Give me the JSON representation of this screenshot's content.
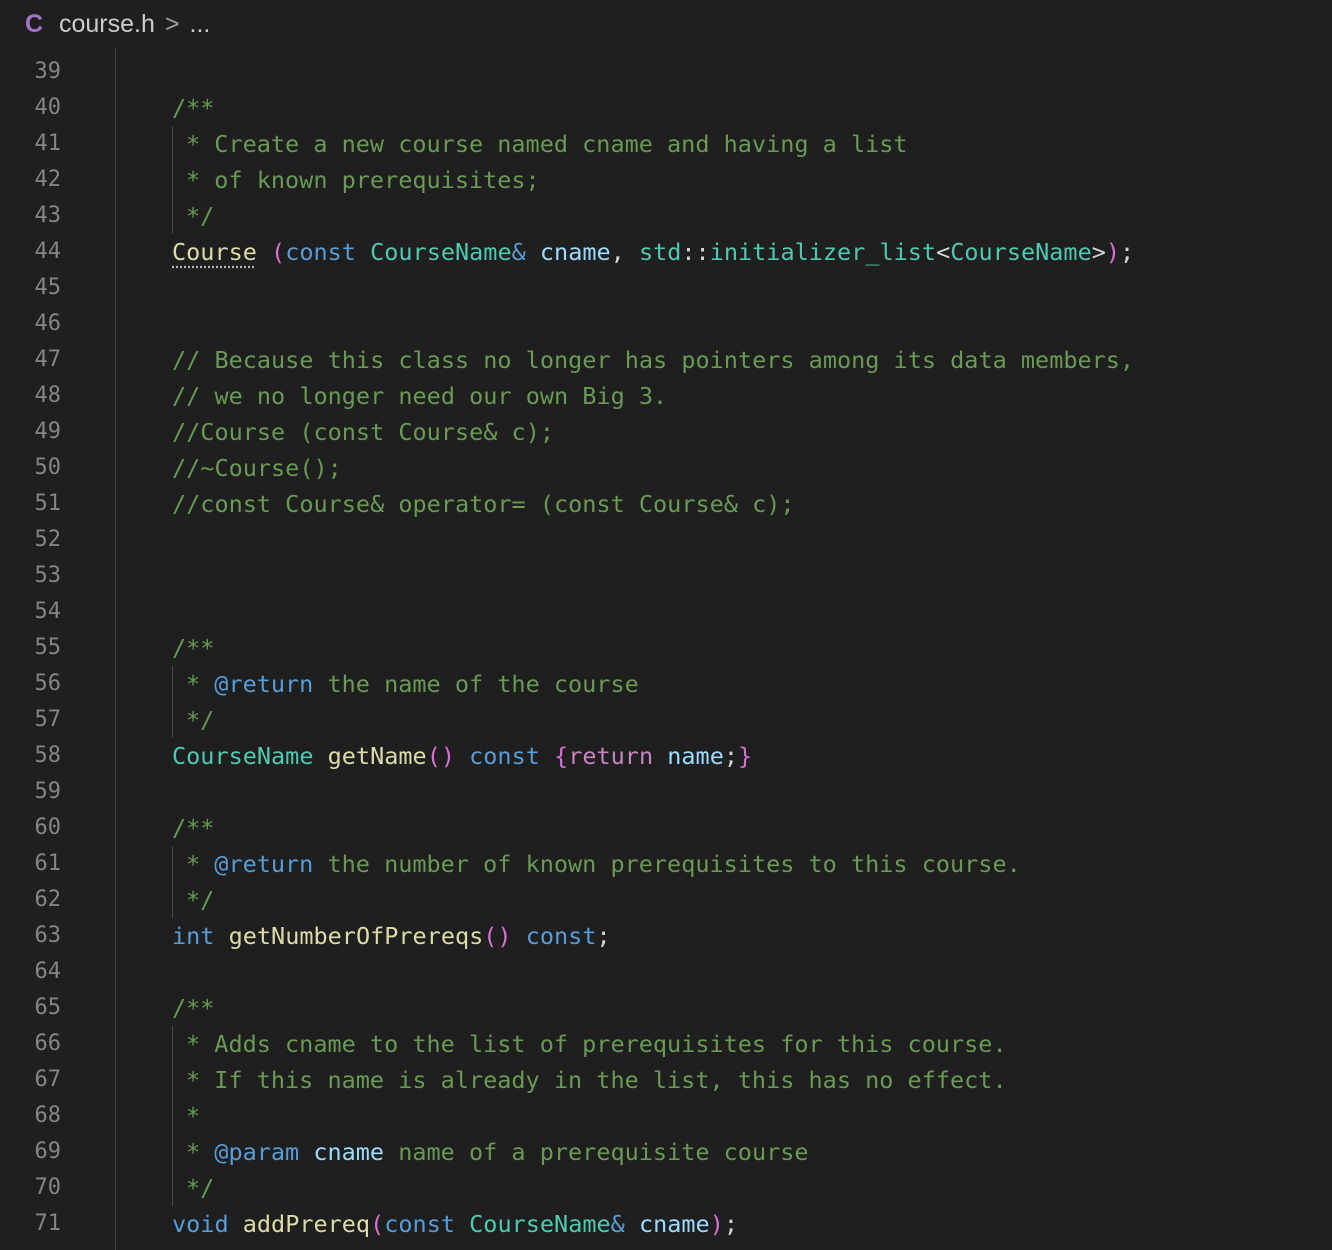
{
  "breadcrumb": {
    "lang_icon": "C",
    "file": "course.h",
    "separator": ">",
    "more": "..."
  },
  "line_numbers": [
    "39",
    "40",
    "41",
    "42",
    "43",
    "44",
    "45",
    "46",
    "47",
    "48",
    "49",
    "50",
    "51",
    "52",
    "53",
    "54",
    "55",
    "56",
    "57",
    "58",
    "59",
    "60",
    "61",
    "62",
    "63",
    "64",
    "65",
    "66",
    "67",
    "68",
    "69",
    "70",
    "71"
  ],
  "code": {
    "l40": "/**",
    "l41": "* Create a new course named cname and having a list",
    "l42": "* of known prerequisites;",
    "l43": "*/",
    "l44": {
      "t1": "Course",
      "t2": " ",
      "t3": "(",
      "t4": "const",
      "t5": " ",
      "t6": "CourseName",
      "t7": "&",
      "t8": " ",
      "t9": "cname",
      "t10": ", ",
      "t11": "std",
      "t12": "::",
      "t13": "initializer_list",
      "t14": "<",
      "t15": "CourseName",
      "t16": ">",
      "t17": ")",
      "t18": ";"
    },
    "l47": "// Because this class no longer has pointers among its data members,",
    "l48": "// we no longer need our own Big 3.",
    "l49": "//Course (const Course& c);",
    "l50": "//~Course();",
    "l51": "//const Course& operator= (const Course& c);",
    "l55": "/**",
    "l56": {
      "a": "* ",
      "b": "@return",
      "c": " the name of the course"
    },
    "l57": "*/",
    "l58": {
      "t1": "CourseName",
      "t2": " ",
      "t3": "getName",
      "t4": "()",
      "t5": " ",
      "t6": "const",
      "t7": " ",
      "t8": "{",
      "t9": "return",
      "t10": " ",
      "t11": "name",
      "t12": ";",
      "t13": "}"
    },
    "l60": "/**",
    "l61": {
      "a": "* ",
      "b": "@return",
      "c": " the number of known prerequisites to this course."
    },
    "l62": "*/",
    "l63": {
      "t1": "int",
      "t2": " ",
      "t3": "getNumberOfPrereqs",
      "t4": "()",
      "t5": " ",
      "t6": "const",
      "t7": ";"
    },
    "l65": "/**",
    "l66": "* Adds cname to the list of prerequisites for this course.",
    "l67": "* If this name is already in the list, this has no effect.",
    "l68": "*",
    "l69": {
      "a": "* ",
      "b": "@param",
      "c": " ",
      "d": "cname",
      "e": " name of a prerequisite course"
    },
    "l70": "*/",
    "l71": {
      "t1": "void",
      "t2": " ",
      "t3": "addPrereq",
      "t4": "(",
      "t5": "const",
      "t6": " ",
      "t7": "CourseName",
      "t8": "&",
      "t9": " ",
      "t10": "cname",
      "t11": ")",
      "t12": ";"
    }
  },
  "colors": {
    "background": "#1f1f1f",
    "comment": "#6a9955",
    "keyword": "#569cd6",
    "type": "#4ec9b0",
    "function": "#dcdcaa",
    "variable": "#9cdcfe",
    "bracket": "#da70d6",
    "line_number": "#858585"
  }
}
